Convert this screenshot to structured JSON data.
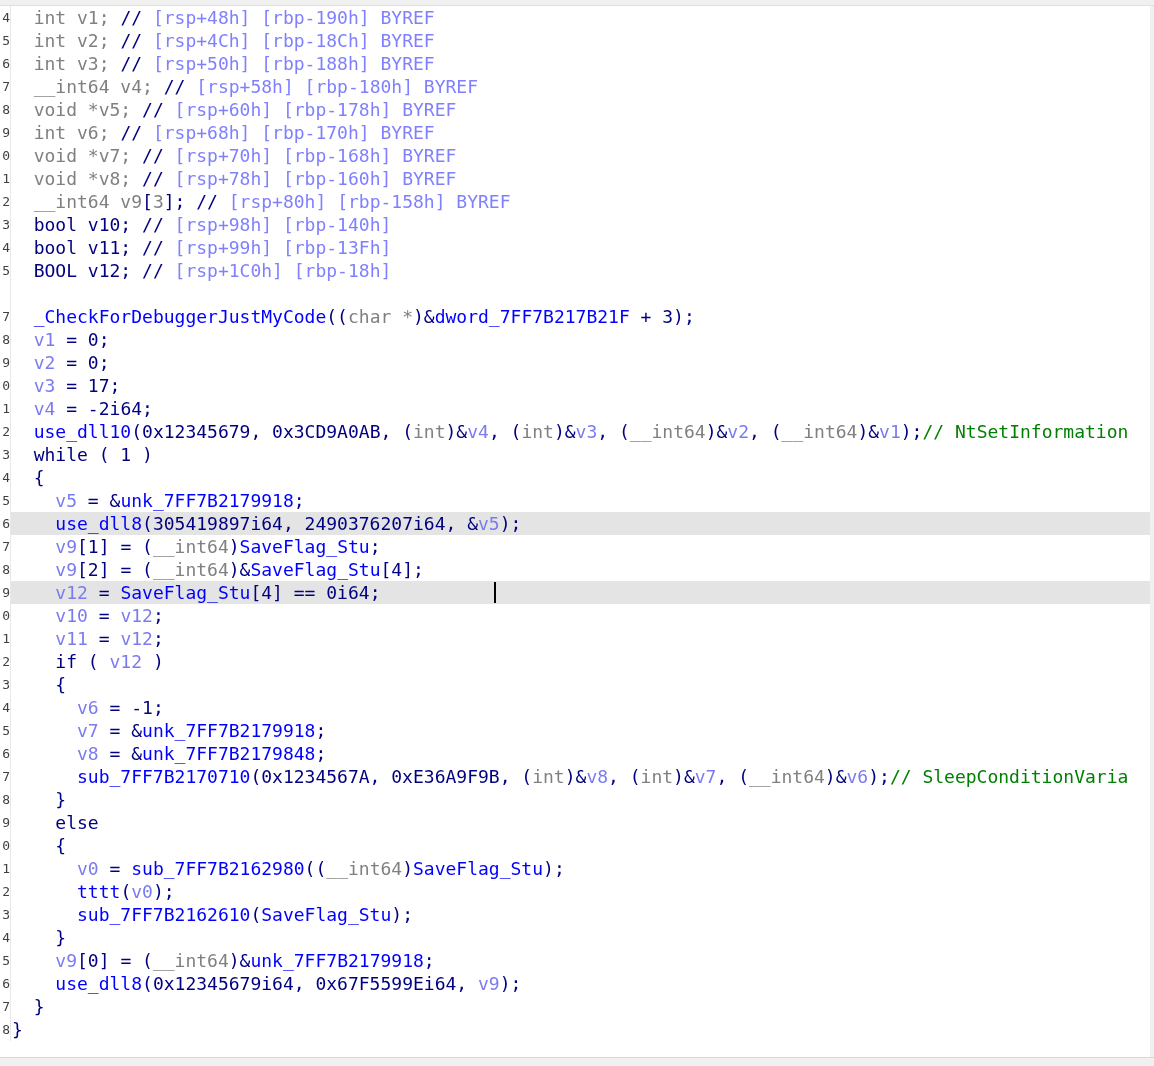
{
  "body": [
    {
      "num": "4",
      "highlighted": false,
      "cursor": false,
      "tokens": [
        {
          "kind": "type",
          "text": "int v1; "
        },
        {
          "kind": "plain",
          "text": "// "
        },
        {
          "kind": "note",
          "text": "[rsp+48h] [rbp-190h] BYREF"
        }
      ]
    },
    {
      "num": "5",
      "highlighted": false,
      "cursor": false,
      "tokens": [
        {
          "kind": "type",
          "text": "int v2; "
        },
        {
          "kind": "plain",
          "text": "// "
        },
        {
          "kind": "note",
          "text": "[rsp+4Ch] [rbp-18Ch] BYREF"
        }
      ]
    },
    {
      "num": "6",
      "highlighted": false,
      "cursor": false,
      "tokens": [
        {
          "kind": "type",
          "text": "int v3; "
        },
        {
          "kind": "plain",
          "text": "// "
        },
        {
          "kind": "note",
          "text": "[rsp+50h] [rbp-188h] BYREF"
        }
      ]
    },
    {
      "num": "7",
      "highlighted": false,
      "cursor": false,
      "tokens": [
        {
          "kind": "type",
          "text": "__int64 v4; "
        },
        {
          "kind": "plain",
          "text": "// "
        },
        {
          "kind": "note",
          "text": "[rsp+58h] [rbp-180h] BYREF"
        }
      ]
    },
    {
      "num": "8",
      "highlighted": false,
      "cursor": false,
      "tokens": [
        {
          "kind": "type",
          "text": "void *v5; "
        },
        {
          "kind": "plain",
          "text": "// "
        },
        {
          "kind": "note",
          "text": "[rsp+60h] [rbp-178h] BYREF"
        }
      ]
    },
    {
      "num": "9",
      "highlighted": false,
      "cursor": false,
      "tokens": [
        {
          "kind": "type",
          "text": "int v6; "
        },
        {
          "kind": "plain",
          "text": "// "
        },
        {
          "kind": "note",
          "text": "[rsp+68h] [rbp-170h] BYREF"
        }
      ]
    },
    {
      "num": "0",
      "highlighted": false,
      "cursor": false,
      "tokens": [
        {
          "kind": "type",
          "text": "void *v7; "
        },
        {
          "kind": "plain",
          "text": "// "
        },
        {
          "kind": "note",
          "text": "[rsp+70h] [rbp-168h] BYREF"
        }
      ]
    },
    {
      "num": "1",
      "highlighted": false,
      "cursor": false,
      "tokens": [
        {
          "kind": "type",
          "text": "void *v8; "
        },
        {
          "kind": "plain",
          "text": "// "
        },
        {
          "kind": "note",
          "text": "[rsp+78h] [rbp-160h] BYREF"
        }
      ]
    },
    {
      "num": "2",
      "highlighted": false,
      "cursor": false,
      "tokens": [
        {
          "kind": "type",
          "text": "__int64 v9"
        },
        {
          "kind": "plain",
          "text": "["
        },
        {
          "kind": "type",
          "text": "3"
        },
        {
          "kind": "plain",
          "text": "]; // "
        },
        {
          "kind": "note",
          "text": "[rsp+80h] [rbp-158h] BYREF"
        }
      ]
    },
    {
      "num": "3",
      "highlighted": false,
      "cursor": false,
      "tokens": [
        {
          "kind": "plain",
          "text": "bool v10; // "
        },
        {
          "kind": "note",
          "text": "[rsp+98h] [rbp-140h]"
        }
      ]
    },
    {
      "num": "4",
      "highlighted": false,
      "cursor": false,
      "tokens": [
        {
          "kind": "plain",
          "text": "bool v11; // "
        },
        {
          "kind": "note",
          "text": "[rsp+99h] [rbp-13Fh]"
        }
      ]
    },
    {
      "num": "5",
      "highlighted": false,
      "cursor": false,
      "tokens": [
        {
          "kind": "plain",
          "text": "BOOL v12; // "
        },
        {
          "kind": "note",
          "text": "[rsp+1C0h] [rbp-18h]"
        }
      ]
    },
    {
      "highlighted": false,
      "cursor": false
    },
    {
      "num": "7",
      "highlighted": false,
      "cursor": false,
      "tokens": [
        {
          "kind": "name",
          "text": "_CheckForDebuggerJustMyCode"
        },
        {
          "kind": "plain",
          "text": "(("
        },
        {
          "kind": "type",
          "text": "char *"
        },
        {
          "kind": "plain",
          "text": ")&"
        },
        {
          "kind": "name",
          "text": "dword_7FF7B217B21F"
        },
        {
          "kind": "plain",
          "text": " + 3);"
        }
      ]
    },
    {
      "num": "8",
      "highlighted": false,
      "cursor": false,
      "tokens": [
        {
          "kind": "var",
          "text": "v1"
        },
        {
          "kind": "plain",
          "text": " = 0;"
        }
      ]
    },
    {
      "num": "9",
      "highlighted": false,
      "cursor": false,
      "tokens": [
        {
          "kind": "var",
          "text": "v2"
        },
        {
          "kind": "plain",
          "text": " = 0;"
        }
      ]
    },
    {
      "num": "0",
      "highlighted": false,
      "cursor": false,
      "tokens": [
        {
          "kind": "var",
          "text": "v3"
        },
        {
          "kind": "plain",
          "text": " = 17;"
        }
      ]
    },
    {
      "num": "1",
      "highlighted": false,
      "cursor": false,
      "tokens": [
        {
          "kind": "var",
          "text": "v4"
        },
        {
          "kind": "plain",
          "text": " = -2i64;"
        }
      ]
    },
    {
      "num": "2",
      "highlighted": false,
      "cursor": false,
      "tokens": [
        {
          "kind": "name",
          "text": "use_dll10"
        },
        {
          "kind": "plain",
          "text": "(0x12345679, 0x3CD9A0AB, ("
        },
        {
          "kind": "type",
          "text": "int"
        },
        {
          "kind": "plain",
          "text": ")&"
        },
        {
          "kind": "var",
          "text": "v4"
        },
        {
          "kind": "plain",
          "text": ", ("
        },
        {
          "kind": "type",
          "text": "int"
        },
        {
          "kind": "plain",
          "text": ")&"
        },
        {
          "kind": "var",
          "text": "v3"
        },
        {
          "kind": "plain",
          "text": ", ("
        },
        {
          "kind": "type",
          "text": "__int64"
        },
        {
          "kind": "plain",
          "text": ")&"
        },
        {
          "kind": "var",
          "text": "v2"
        },
        {
          "kind": "plain",
          "text": ", ("
        },
        {
          "kind": "type",
          "text": "__int64"
        },
        {
          "kind": "plain",
          "text": ")&"
        },
        {
          "kind": "var",
          "text": "v1"
        },
        {
          "kind": "plain",
          "text": ");"
        },
        {
          "kind": "comment",
          "text": "// NtSetInformation"
        }
      ]
    },
    {
      "num": "3",
      "highlighted": false,
      "cursor": false,
      "tokens": [
        {
          "kind": "plain",
          "text": "while ( 1 )"
        }
      ]
    },
    {
      "num": "4",
      "highlighted": false,
      "cursor": false,
      "tokens": [
        {
          "kind": "plain",
          "text": "{"
        }
      ],
      "children": [
        {
          "num": "5",
          "highlighted": false,
          "cursor": false,
          "tokens": [
            {
              "kind": "var",
              "text": "v5"
            },
            {
              "kind": "plain",
              "text": " = &"
            },
            {
              "kind": "name",
              "text": "unk_7FF7B2179918"
            },
            {
              "kind": "plain",
              "text": ";"
            }
          ]
        },
        {
          "num": "6",
          "highlighted": true,
          "cursor": false,
          "tokens": [
            {
              "kind": "name",
              "text": "use_dll8"
            },
            {
              "kind": "plain",
              "text": "(305419897i64, 2490376207i64, &"
            },
            {
              "kind": "var",
              "text": "v5"
            },
            {
              "kind": "plain",
              "text": ");"
            }
          ]
        },
        {
          "num": "7",
          "highlighted": false,
          "cursor": false,
          "tokens": [
            {
              "kind": "var",
              "text": "v9"
            },
            {
              "kind": "plain",
              "text": "[1] = ("
            },
            {
              "kind": "type",
              "text": "__int64"
            },
            {
              "kind": "plain",
              "text": ")"
            },
            {
              "kind": "name",
              "text": "SaveFlag_Stu"
            },
            {
              "kind": "plain",
              "text": ";"
            }
          ]
        },
        {
          "num": "8",
          "highlighted": false,
          "cursor": false,
          "tokens": [
            {
              "kind": "var",
              "text": "v9"
            },
            {
              "kind": "plain",
              "text": "[2] = ("
            },
            {
              "kind": "type",
              "text": "__int64"
            },
            {
              "kind": "plain",
              "text": ")&"
            },
            {
              "kind": "name",
              "text": "SaveFlag_Stu"
            },
            {
              "kind": "plain",
              "text": "[4];"
            }
          ]
        },
        {
          "num": "9",
          "highlighted": true,
          "cursor": true,
          "tokens": [
            {
              "kind": "var",
              "text": "v12"
            },
            {
              "kind": "plain",
              "text": " = "
            },
            {
              "kind": "name",
              "text": "SaveFlag_Stu"
            },
            {
              "kind": "plain",
              "text": "[4] == 0i64;"
            }
          ]
        },
        {
          "num": "0",
          "highlighted": false,
          "cursor": false,
          "tokens": [
            {
              "kind": "var",
              "text": "v10"
            },
            {
              "kind": "plain",
              "text": " = "
            },
            {
              "kind": "var",
              "text": "v12"
            },
            {
              "kind": "plain",
              "text": ";"
            }
          ]
        },
        {
          "num": "1",
          "highlighted": false,
          "cursor": false,
          "tokens": [
            {
              "kind": "var",
              "text": "v11"
            },
            {
              "kind": "plain",
              "text": " = "
            },
            {
              "kind": "var",
              "text": "v12"
            },
            {
              "kind": "plain",
              "text": ";"
            }
          ]
        },
        {
          "num": "2",
          "highlighted": false,
          "cursor": false,
          "tokens": [
            {
              "kind": "plain",
              "text": "if ( "
            },
            {
              "kind": "var",
              "text": "v12"
            },
            {
              "kind": "plain",
              "text": " )"
            }
          ]
        },
        {
          "num": "3",
          "highlighted": false,
          "cursor": false,
          "tokens": [
            {
              "kind": "plain",
              "text": "{"
            }
          ],
          "children": [
            {
              "num": "4",
              "highlighted": false,
              "cursor": false,
              "tokens": [
                {
                  "kind": "var",
                  "text": "v6"
                },
                {
                  "kind": "plain",
                  "text": " = -1;"
                }
              ]
            },
            {
              "num": "5",
              "highlighted": false,
              "cursor": false,
              "tokens": [
                {
                  "kind": "var",
                  "text": "v7"
                },
                {
                  "kind": "plain",
                  "text": " = &"
                },
                {
                  "kind": "name",
                  "text": "unk_7FF7B2179918"
                },
                {
                  "kind": "plain",
                  "text": ";"
                }
              ]
            },
            {
              "num": "6",
              "highlighted": false,
              "cursor": false,
              "tokens": [
                {
                  "kind": "var",
                  "text": "v8"
                },
                {
                  "kind": "plain",
                  "text": " = &"
                },
                {
                  "kind": "name",
                  "text": "unk_7FF7B2179848"
                },
                {
                  "kind": "plain",
                  "text": ";"
                }
              ]
            },
            {
              "num": "7",
              "highlighted": false,
              "cursor": false,
              "tokens": [
                {
                  "kind": "name",
                  "text": "sub_7FF7B2170710"
                },
                {
                  "kind": "plain",
                  "text": "(0x1234567A, 0xE36A9F9B, ("
                },
                {
                  "kind": "type",
                  "text": "int"
                },
                {
                  "kind": "plain",
                  "text": ")&"
                },
                {
                  "kind": "var",
                  "text": "v8"
                },
                {
                  "kind": "plain",
                  "text": ", ("
                },
                {
                  "kind": "type",
                  "text": "int"
                },
                {
                  "kind": "plain",
                  "text": ")&"
                },
                {
                  "kind": "var",
                  "text": "v7"
                },
                {
                  "kind": "plain",
                  "text": ", ("
                },
                {
                  "kind": "type",
                  "text": "__int64"
                },
                {
                  "kind": "plain",
                  "text": ")&"
                },
                {
                  "kind": "var",
                  "text": "v6"
                },
                {
                  "kind": "plain",
                  "text": ");"
                },
                {
                  "kind": "comment",
                  "text": "// SleepConditionVaria"
                }
              ]
            }
          ]
        },
        {
          "num": "8",
          "highlighted": false,
          "cursor": false,
          "tokens": [
            {
              "kind": "plain",
              "text": "}"
            }
          ]
        },
        {
          "num": "9",
          "highlighted": false,
          "cursor": false,
          "tokens": [
            {
              "kind": "plain",
              "text": "else"
            }
          ]
        },
        {
          "num": "0",
          "highlighted": false,
          "cursor": false,
          "tokens": [
            {
              "kind": "plain",
              "text": "{"
            }
          ],
          "children": [
            {
              "num": "1",
              "highlighted": false,
              "cursor": false,
              "tokens": [
                {
                  "kind": "var",
                  "text": "v0"
                },
                {
                  "kind": "plain",
                  "text": " = "
                },
                {
                  "kind": "name",
                  "text": "sub_7FF7B2162980"
                },
                {
                  "kind": "plain",
                  "text": "(("
                },
                {
                  "kind": "type",
                  "text": "__int64"
                },
                {
                  "kind": "plain",
                  "text": ")"
                },
                {
                  "kind": "name",
                  "text": "SaveFlag_Stu"
                },
                {
                  "kind": "plain",
                  "text": ");"
                }
              ]
            },
            {
              "num": "2",
              "highlighted": false,
              "cursor": false,
              "tokens": [
                {
                  "kind": "name",
                  "text": "tttt"
                },
                {
                  "kind": "plain",
                  "text": "("
                },
                {
                  "kind": "var",
                  "text": "v0"
                },
                {
                  "kind": "plain",
                  "text": ");"
                }
              ]
            },
            {
              "num": "3",
              "highlighted": false,
              "cursor": false,
              "tokens": [
                {
                  "kind": "name",
                  "text": "sub_7FF7B2162610"
                },
                {
                  "kind": "plain",
                  "text": "("
                },
                {
                  "kind": "name",
                  "text": "SaveFlag_Stu"
                },
                {
                  "kind": "plain",
                  "text": ");"
                }
              ]
            }
          ]
        },
        {
          "num": "4",
          "highlighted": false,
          "cursor": false,
          "tokens": [
            {
              "kind": "plain",
              "text": "}"
            }
          ]
        },
        {
          "num": "5",
          "highlighted": false,
          "cursor": false,
          "tokens": [
            {
              "kind": "var",
              "text": "v9"
            },
            {
              "kind": "plain",
              "text": "[0] = ("
            },
            {
              "kind": "type",
              "text": "__int64"
            },
            {
              "kind": "plain",
              "text": ")&"
            },
            {
              "kind": "name",
              "text": "unk_7FF7B2179918"
            },
            {
              "kind": "plain",
              "text": ";"
            }
          ]
        },
        {
          "num": "6",
          "highlighted": false,
          "cursor": false,
          "tokens": [
            {
              "kind": "name",
              "text": "use_dll8"
            },
            {
              "kind": "plain",
              "text": "(0x12345679i64, 0x67F5599Ei64, "
            },
            {
              "kind": "var",
              "text": "v9"
            },
            {
              "kind": "plain",
              "text": ");"
            }
          ]
        }
      ]
    },
    {
      "num": "7",
      "highlighted": false,
      "cursor": false,
      "tokens": [
        {
          "kind": "plain",
          "text": "}"
        }
      ]
    }
  ],
  "closing": {
    "num": "8",
    "highlighted": false,
    "cursor": false,
    "tokens": [
      {
        "kind": "plain",
        "text": "}"
      }
    ]
  }
}
